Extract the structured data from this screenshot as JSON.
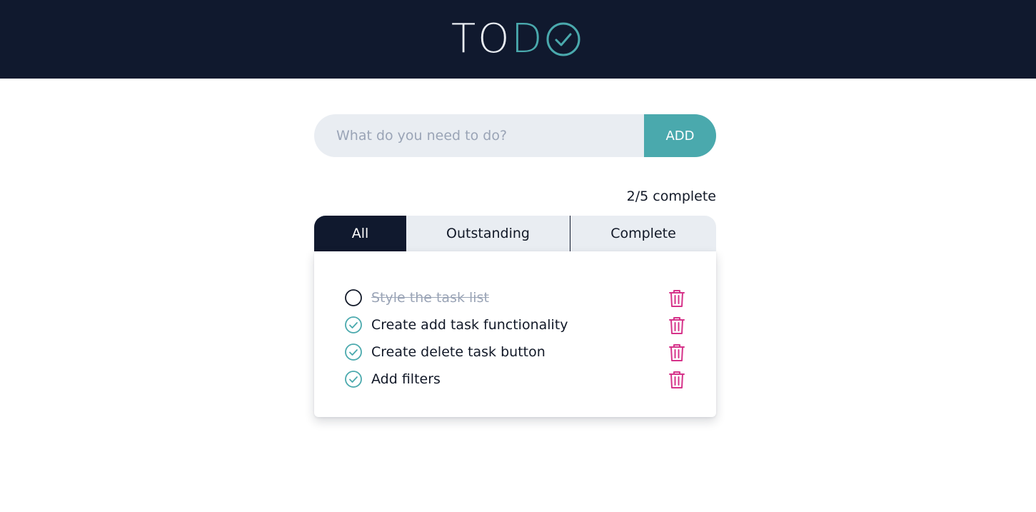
{
  "app": {
    "logo_part1": "TO",
    "logo_part2": "D",
    "logo_icon": "check-circle-icon",
    "accent_color": "#4aa9ad",
    "header_color": "#10192e",
    "danger_color": "#d6338a"
  },
  "add_task": {
    "placeholder": "What do you need to do?",
    "value": "",
    "button_label": "ADD"
  },
  "progress": {
    "text": "2/5 complete"
  },
  "filters": {
    "tabs": [
      {
        "label": "All",
        "active": true
      },
      {
        "label": "Outstanding",
        "active": false
      },
      {
        "label": "Complete",
        "active": false
      }
    ]
  },
  "tasks": [
    {
      "text": "Style the task list",
      "status_icon": "empty-circle-icon",
      "struck_through": true,
      "action_icon": "trash-icon"
    },
    {
      "text": "Create add task functionality",
      "status_icon": "check-circle-icon",
      "struck_through": false,
      "action_icon": "trash-icon"
    },
    {
      "text": "Create delete task button",
      "status_icon": "check-circle-icon",
      "struck_through": false,
      "action_icon": "trash-icon"
    },
    {
      "text": "Add filters",
      "status_icon": "check-circle-icon",
      "struck_through": false,
      "action_icon": "trash-icon"
    }
  ]
}
